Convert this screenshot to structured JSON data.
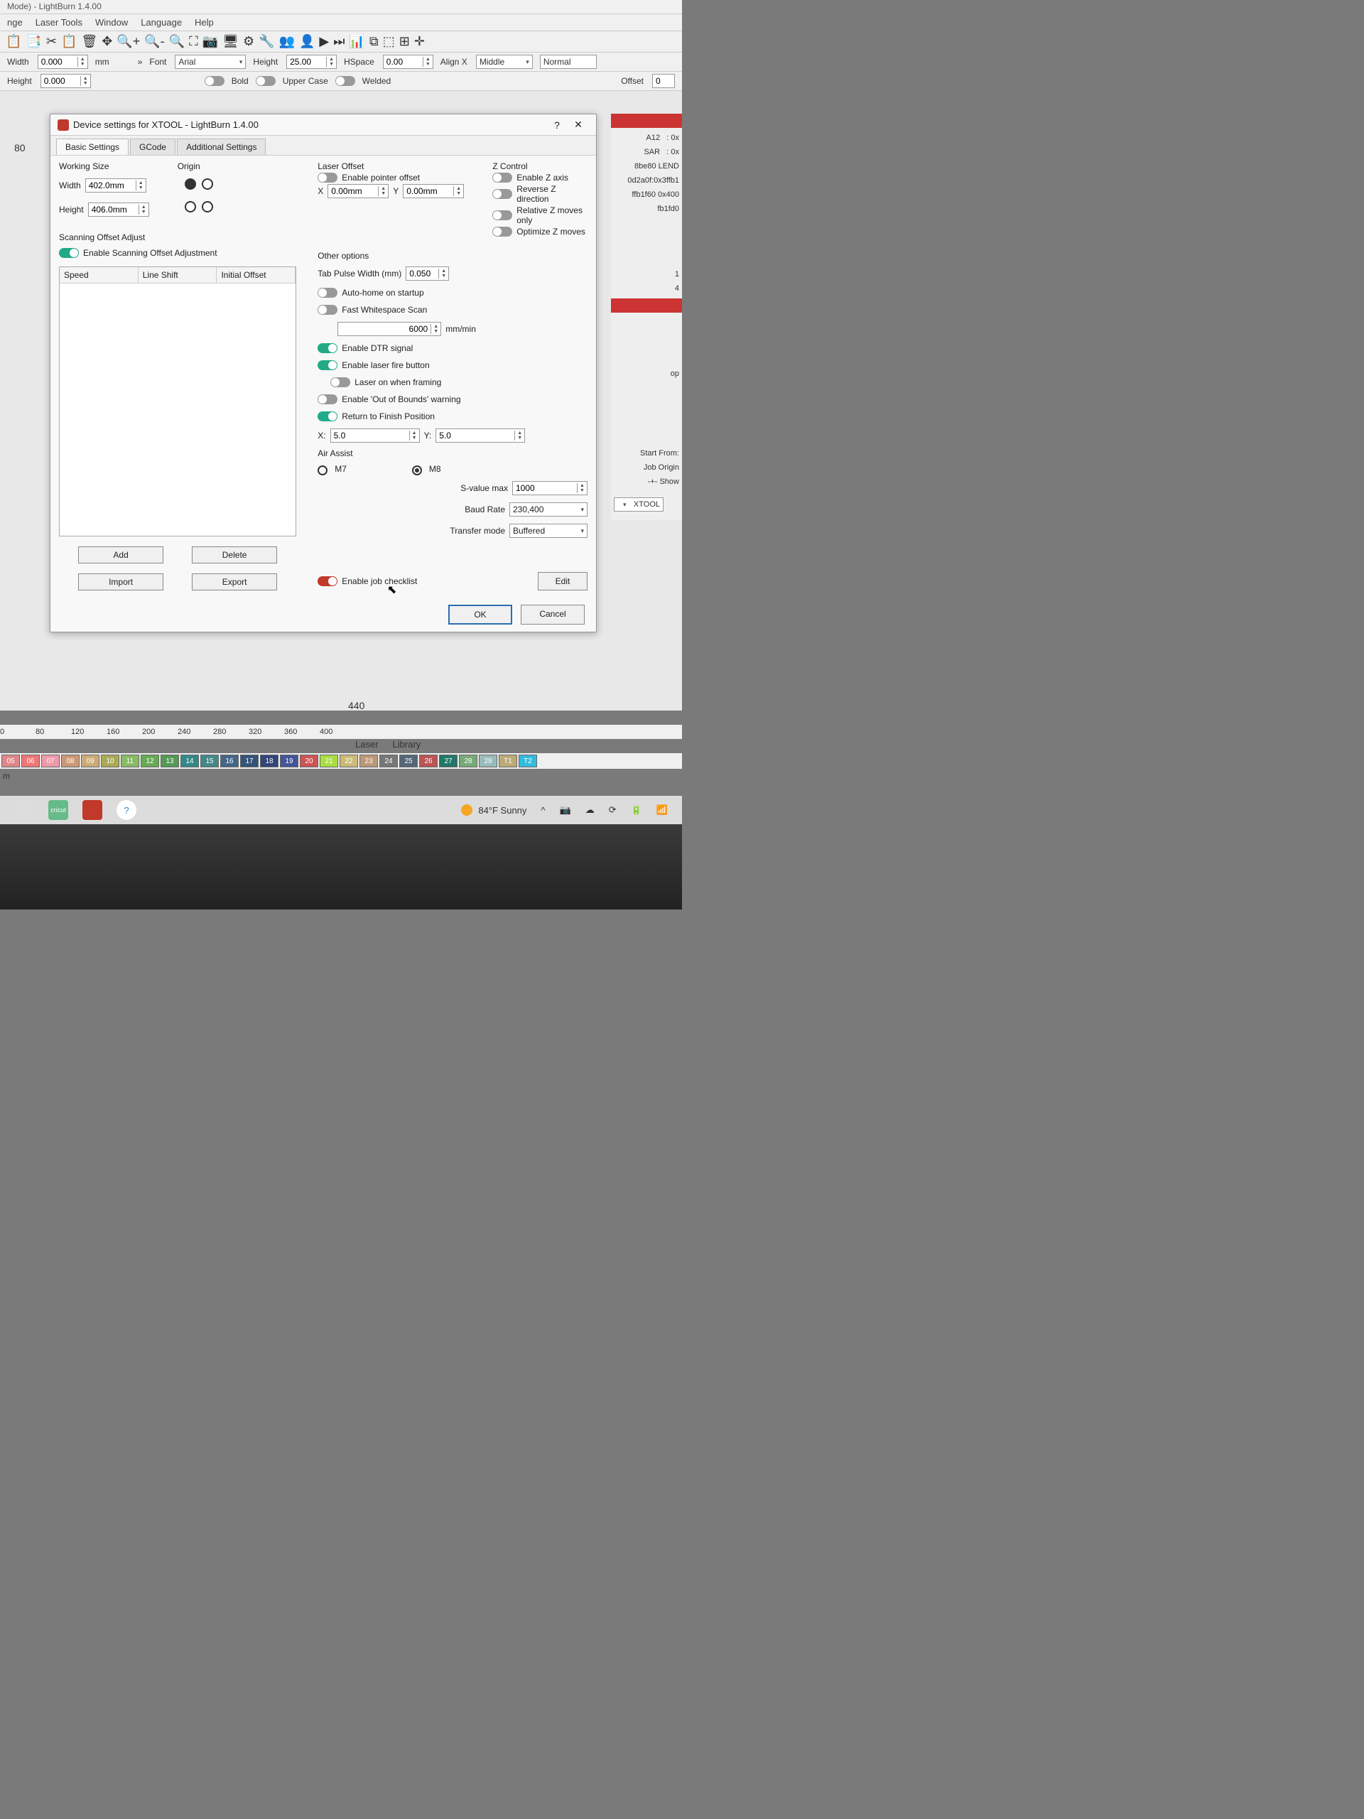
{
  "app": {
    "title_fragment": "Mode) - LightBurn 1.4.00"
  },
  "menu": [
    "nge",
    "Laser Tools",
    "Window",
    "Language",
    "Help"
  ],
  "toolbar_icons": [
    "📋",
    "📑",
    "✂",
    "📋",
    "🗑",
    "✥",
    "🔍+",
    "🔍-",
    "🔍",
    "⛶",
    "📷",
    "🖥",
    "⚙",
    "🔧",
    "👥",
    "👤",
    "▶",
    "⏭",
    "📊",
    "⧉",
    "⬚",
    "⊞",
    "✛"
  ],
  "props": {
    "width_label": "Width",
    "width_value": "0.000",
    "width_unit": "mm",
    "height_label": "Height",
    "height_value": "0.000",
    "font_label": "Font",
    "font_value": "Arial",
    "char_height_label": "Height",
    "char_height_value": "25.00",
    "hspace_label": "HSpace",
    "hspace_value": "0.00",
    "alignx_label": "Align X",
    "alignx_value": "Middle",
    "style_value": "Normal",
    "bold": "Bold",
    "upper": "Upper Case",
    "welded": "Welded",
    "offset_label": "Offset",
    "offset_value": "0"
  },
  "ruler_axis_label": "80",
  "ruler_marks": [
    "0",
    "80",
    "120",
    "160",
    "200",
    "240",
    "280",
    "320",
    "360",
    "400",
    "440"
  ],
  "canvas_center_label": "440",
  "palette": [
    {
      "n": "05",
      "c": "#d88"
    },
    {
      "n": "06",
      "c": "#e77"
    },
    {
      "n": "07",
      "c": "#e9a"
    },
    {
      "n": "08",
      "c": "#c97"
    },
    {
      "n": "09",
      "c": "#ca7"
    },
    {
      "n": "10",
      "c": "#aa5"
    },
    {
      "n": "11",
      "c": "#8b6"
    },
    {
      "n": "12",
      "c": "#6a5"
    },
    {
      "n": "13",
      "c": "#595"
    },
    {
      "n": "14",
      "c": "#388"
    },
    {
      "n": "15",
      "c": "#488"
    },
    {
      "n": "16",
      "c": "#468"
    },
    {
      "n": "17",
      "c": "#357"
    },
    {
      "n": "18",
      "c": "#347"
    },
    {
      "n": "19",
      "c": "#459"
    },
    {
      "n": "20",
      "c": "#c55"
    },
    {
      "n": "21",
      "c": "#ad4"
    },
    {
      "n": "22",
      "c": "#cb7"
    },
    {
      "n": "23",
      "c": "#b97"
    },
    {
      "n": "24",
      "c": "#777"
    },
    {
      "n": "25",
      "c": "#567"
    },
    {
      "n": "26",
      "c": "#b55"
    },
    {
      "n": "27",
      "c": "#276"
    },
    {
      "n": "28",
      "c": "#7a7"
    },
    {
      "n": "29",
      "c": "#9bb"
    },
    {
      "n": "T1",
      "c": "#ba7"
    },
    {
      "n": "T2",
      "c": "#3bd"
    }
  ],
  "bottom_tabs": [
    "Laser",
    "Library"
  ],
  "right_panel": {
    "a12": "A12",
    "a12_val": ": 0x",
    "sar": "SAR",
    "sar_val": ": 0x",
    "lend": "8be80  LEND",
    "hex1": "0d2a0f:0x3ffb1",
    "hex2": "ffb1f60 0x400",
    "hex3": "fb1fd0",
    "one": "1",
    "four": "4",
    "op": "op",
    "start_from": "Start From:",
    "job_origin": "Job Origin",
    "show": "Show",
    "device": "XTOOL"
  },
  "dialog": {
    "title": "Device settings for XTOOL - LightBurn 1.4.00",
    "tabs": [
      "Basic Settings",
      "GCode",
      "Additional Settings"
    ],
    "active_tab": 0,
    "working_size": {
      "header": "Working Size",
      "width_label": "Width",
      "width_value": "402.0mm",
      "height_label": "Height",
      "height_value": "406.0mm"
    },
    "origin_header": "Origin",
    "laser_offset": {
      "header": "Laser Offset",
      "enable_label": "Enable pointer offset",
      "x_label": "X",
      "x_value": "0.00mm",
      "y_label": "Y",
      "y_value": "0.00mm"
    },
    "zcontrol": {
      "header": "Z Control",
      "enable_z": "Enable Z axis",
      "reverse_z": "Reverse Z direction",
      "relative_z": "Relative Z moves only",
      "optimize_z": "Optimize Z moves"
    },
    "scanning": {
      "header": "Scanning Offset Adjust",
      "enable_label": "Enable Scanning Offset Adjustment",
      "col_speed": "Speed",
      "col_lineshift": "Line Shift",
      "col_initoffset": "Initial Offset",
      "add": "Add",
      "delete": "Delete",
      "import": "Import",
      "export": "Export"
    },
    "other": {
      "header": "Other options",
      "tab_pulse_label": "Tab Pulse Width (mm)",
      "tab_pulse_value": "0.050",
      "auto_home": "Auto-home on startup",
      "fast_ws": "Fast Whitespace Scan",
      "fast_ws_value": "6000",
      "fast_ws_unit": "mm/min",
      "enable_dtr": "Enable DTR signal",
      "enable_fire": "Enable laser fire button",
      "laser_on_framing": "Laser on when framing",
      "oob_warning": "Enable 'Out of Bounds' warning",
      "return_finish": "Return to Finish Position",
      "x_label": "X:",
      "x_value": "5.0",
      "y_label": "Y:",
      "y_value": "5.0",
      "air_assist": "Air Assist",
      "m7": "M7",
      "m8": "M8",
      "svalue_label": "S-value max",
      "svalue_value": "1000",
      "baud_label": "Baud Rate",
      "baud_value": "230,400",
      "transfer_label": "Transfer mode",
      "transfer_value": "Buffered",
      "enable_checklist": "Enable job checklist",
      "edit": "Edit"
    },
    "ok": "OK",
    "cancel": "Cancel"
  },
  "taskbar": {
    "app1": "cricut",
    "weather": "84°F  Sunny"
  }
}
